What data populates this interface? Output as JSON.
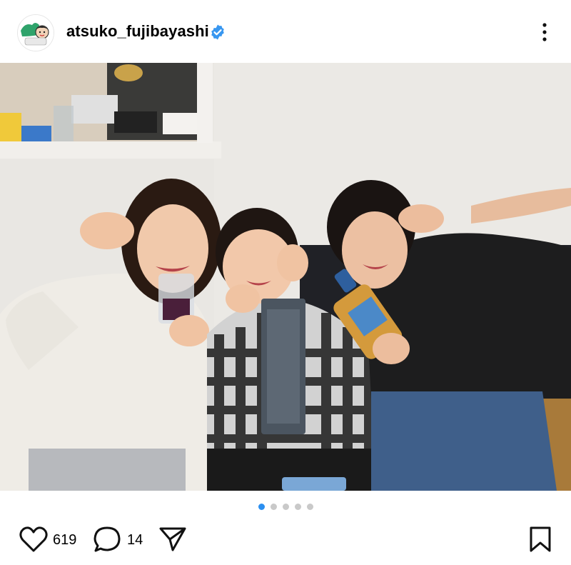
{
  "post": {
    "username": "atsuko_fujibayashi",
    "verified": true,
    "image_alt": "",
    "carousel": {
      "total": 5,
      "current": 1
    },
    "likes": "619",
    "comments": "14"
  },
  "colors": {
    "accent": "#2b8ff0",
    "verified": "#3897f0",
    "dot_inactive": "#c9c9c9"
  },
  "icons": {
    "more": "more-vertical-icon",
    "like": "heart-icon",
    "comment": "comment-icon",
    "share": "send-icon",
    "save": "bookmark-icon"
  }
}
